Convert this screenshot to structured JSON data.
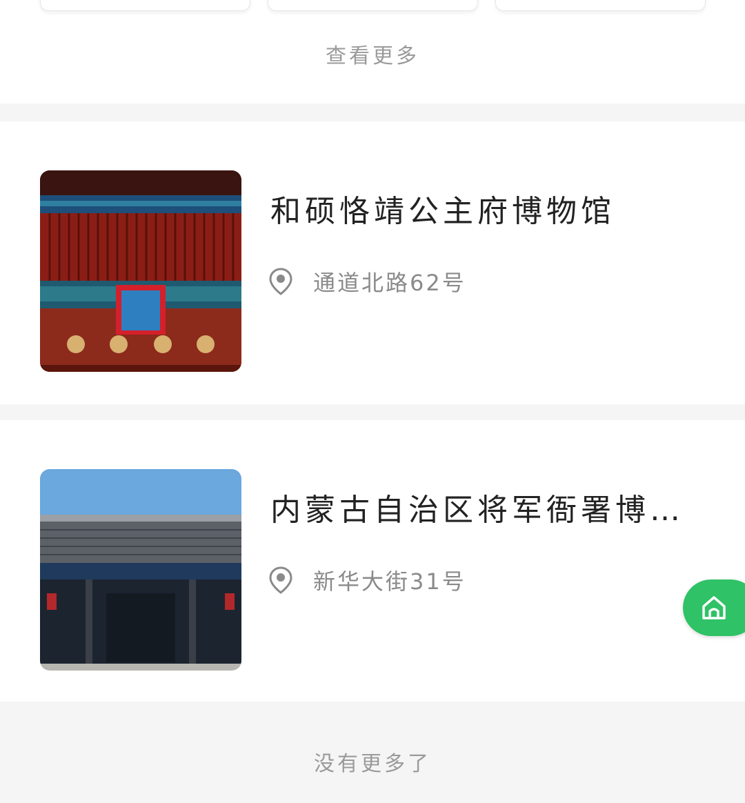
{
  "more_link": {
    "label": "查看更多"
  },
  "cards": [
    {
      "title": "和硕恪靖公主府博物馆",
      "address": "通道北路62号",
      "icon": "location-pin-icon"
    },
    {
      "title": "内蒙古自治区将军衙署博物院",
      "address": "新华大街31号",
      "icon": "location-pin-icon"
    }
  ],
  "end_text": "没有更多了",
  "fab": {
    "icon": "home-icon",
    "color": "#2fc266"
  }
}
